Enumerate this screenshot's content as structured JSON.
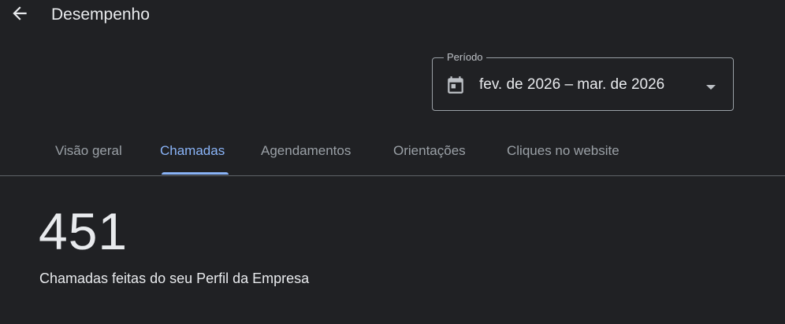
{
  "header": {
    "title": "Desempenho",
    "back_icon": "arrow-back-icon"
  },
  "period": {
    "legend": "Período",
    "value": "fev. de 2026 – mar. de 2026",
    "calendar_icon": "calendar-icon",
    "caret_icon": "arrow-drop-down-icon"
  },
  "tabs": [
    {
      "label": "Visão geral",
      "active": false
    },
    {
      "label": "Chamadas",
      "active": true
    },
    {
      "label": "Agendamentos",
      "active": false
    },
    {
      "label": "Orientações",
      "active": false
    },
    {
      "label": "Cliques no website",
      "active": false
    }
  ],
  "metric": {
    "value": "451",
    "label": "Chamadas feitas do seu Perfil da Empresa"
  },
  "colors": {
    "background": "#202124",
    "text": "#e8eaed",
    "muted": "#9aa0a6",
    "accent": "#8ab4f8",
    "divider": "#5f6368"
  }
}
